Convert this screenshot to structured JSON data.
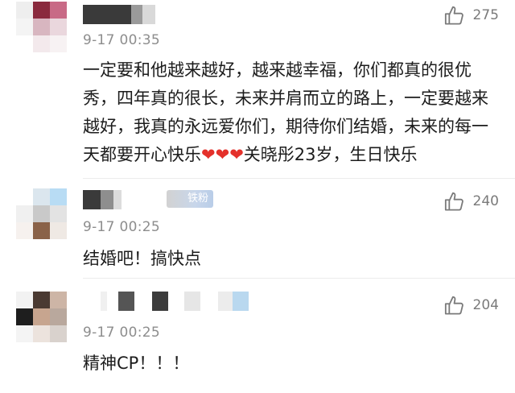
{
  "comments": [
    {
      "time": "9-17 00:35",
      "likes": "275",
      "text_main": "一定要和他越来越好，越来越幸福，你们都真的很优秀，四年真的很长，未来并肩而立的路上，一定要越来越好，我真的永远爱你们，期待你们结婚，未来的每一天都要开心快乐",
      "hearts": "❤❤❤",
      "text_tail": "关晓彤23岁，生日快乐"
    },
    {
      "time": "9-17 00:25",
      "likes": "240",
      "badge": "铁粉",
      "text": "结婚吧！搞快点"
    },
    {
      "time": "9-17 00:25",
      "likes": "204",
      "text": "精神CP！！！"
    }
  ],
  "icons": {
    "like": "thumbs-up-icon"
  },
  "colors": {
    "heart": "#e4312b",
    "meta": "#8d8d8d"
  }
}
